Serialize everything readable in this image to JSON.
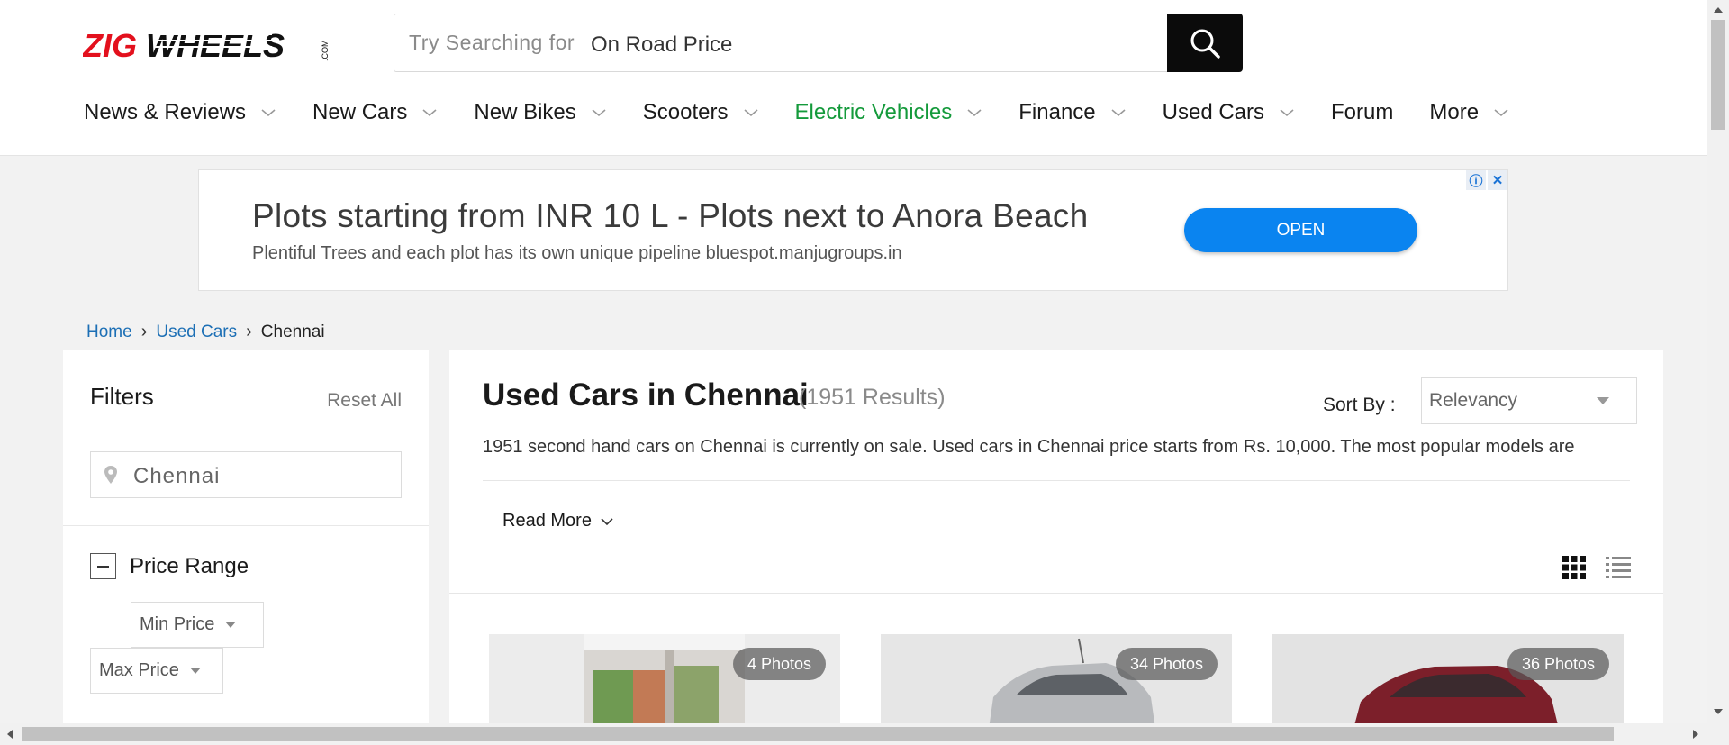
{
  "header": {
    "logo_text": "ZIGWHEELS",
    "logo_suffix": ".COM",
    "search": {
      "hint": "Try Searching for",
      "value": "On Road Price",
      "button_icon": "search-icon"
    },
    "nav": [
      {
        "label": "News & Reviews",
        "has_dropdown": true
      },
      {
        "label": "New Cars",
        "has_dropdown": true
      },
      {
        "label": "New Bikes",
        "has_dropdown": true
      },
      {
        "label": "Scooters",
        "has_dropdown": true
      },
      {
        "label": "Electric Vehicles",
        "has_dropdown": true,
        "color": "#149a3b"
      },
      {
        "label": "Finance",
        "has_dropdown": true
      },
      {
        "label": "Used Cars",
        "has_dropdown": true
      },
      {
        "label": "Forum",
        "has_dropdown": false
      },
      {
        "label": "More",
        "has_dropdown": true
      }
    ]
  },
  "ad": {
    "title": "Plots starting from INR 10 L - Plots next to Anora Beach",
    "subtitle": "Plentiful Trees and each plot has its own unique pipeline bluespot.manjugroups.in",
    "button": "OPEN",
    "button_color": "#0a84f0"
  },
  "breadcrumb": {
    "home": "Home",
    "used_cars": "Used Cars",
    "current": "Chennai"
  },
  "filters": {
    "title": "Filters",
    "reset": "Reset All",
    "location_value": "Chennai",
    "price_range": {
      "title": "Price Range",
      "min_placeholder": "Min Price",
      "max_placeholder": "Max Price"
    }
  },
  "main": {
    "title": "Used Cars in Chennai",
    "count": "(1951 Results)",
    "sort_label": "Sort By :",
    "sort_value": "Relevancy",
    "description": "1951 second hand cars on Chennai is currently on sale. Used cars in Chennai price starts from Rs. 10,000. The most popular models are",
    "read_more": "Read More",
    "cards": [
      {
        "photos": "4 Photos"
      },
      {
        "photos": "34 Photos"
      },
      {
        "photos": "36 Photos"
      }
    ]
  }
}
